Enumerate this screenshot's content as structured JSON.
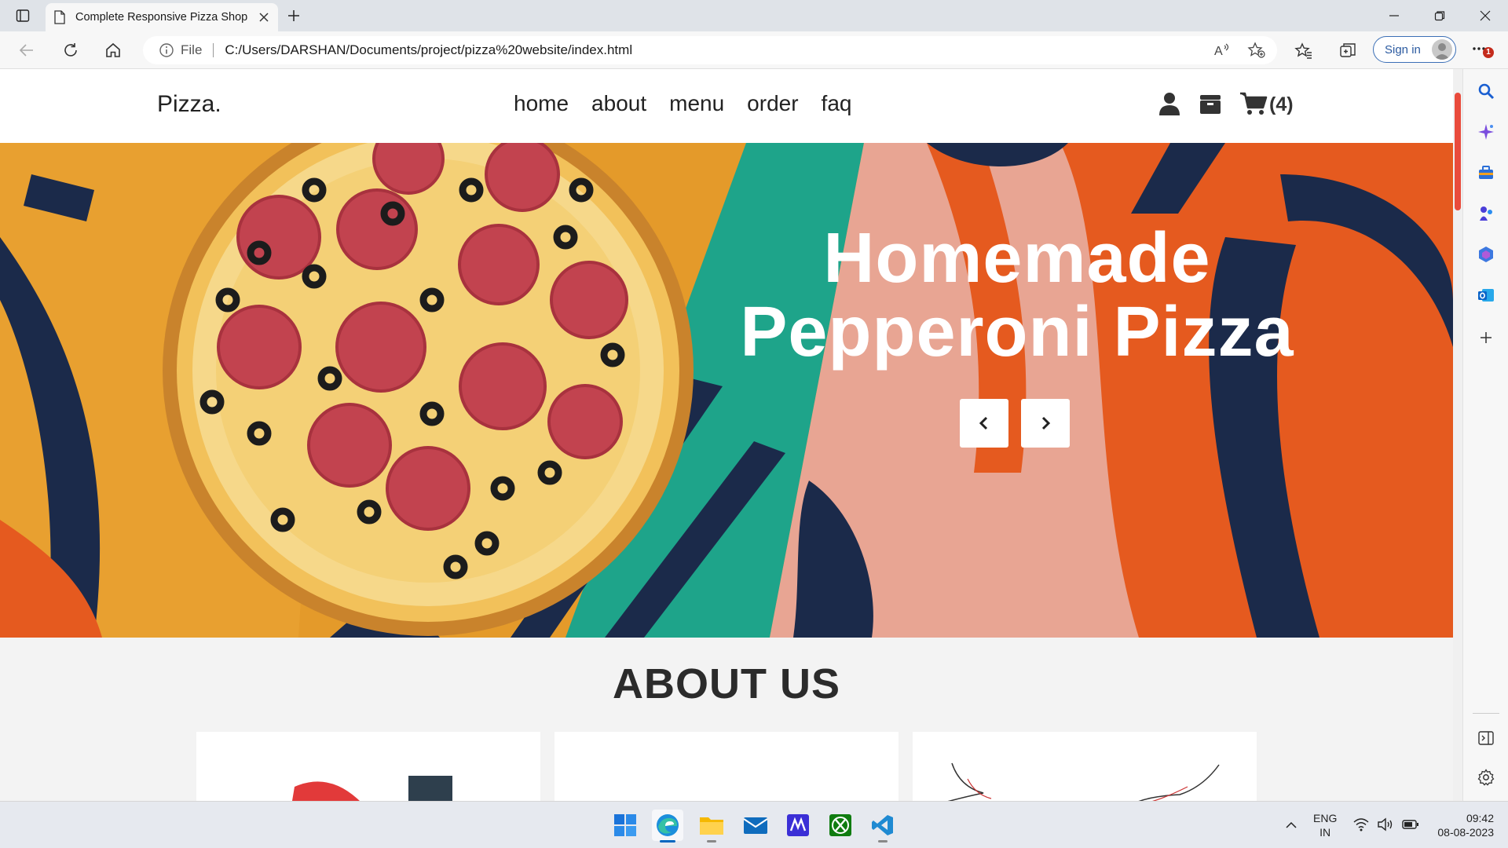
{
  "browser": {
    "tab_title": "Complete Responsive Pizza Shop",
    "protocol_label": "File",
    "url": "C:/Users/DARSHAN/Documents/project/pizza%20website/index.html",
    "sign_in_label": "Sign in",
    "notification_badge": "1"
  },
  "site": {
    "logo": "Pizza.",
    "nav": [
      "home",
      "about",
      "menu",
      "order",
      "faq"
    ],
    "cart_count": "(4)"
  },
  "hero": {
    "title_line1": "Homemade",
    "title_line2": "Pepperoni Pizza"
  },
  "about": {
    "heading": "ABOUT US"
  },
  "taskbar": {
    "lang_line1": "ENG",
    "lang_line2": "IN",
    "time": "09:42",
    "date": "08-08-2023"
  },
  "colors": {
    "accent_red": "#e94b3c",
    "edge_blue": "#0067c0",
    "hero_orange": "#e55a1f",
    "hero_teal": "#1ea48a",
    "hero_navy": "#1b2a4a"
  }
}
